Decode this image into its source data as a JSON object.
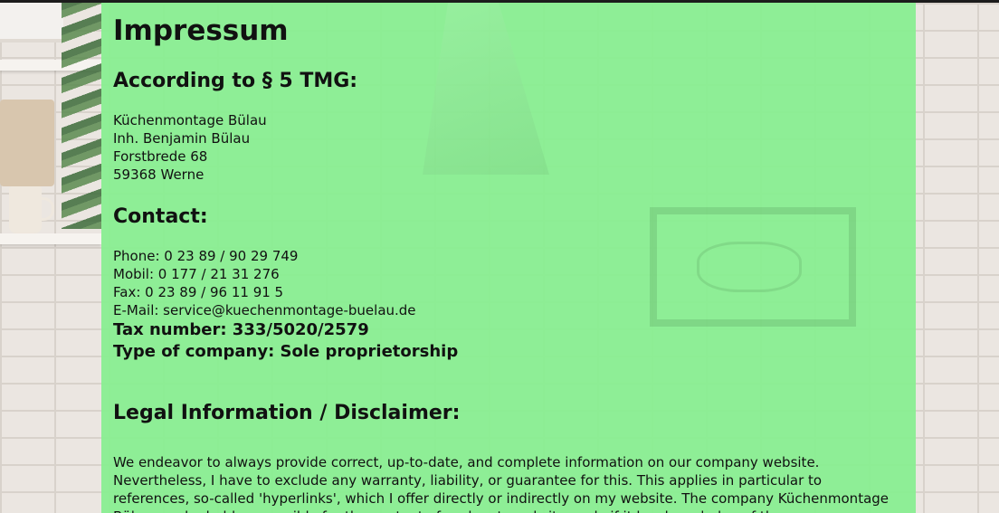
{
  "page": {
    "title": "Impressum"
  },
  "tmg": {
    "heading": "According to § 5 TMG:",
    "lines": [
      "Küchenmontage Bülau",
      "Inh. Benjamin Bülau",
      "Forstbrede 68",
      "59368 Werne"
    ]
  },
  "contact": {
    "heading": "Contact:",
    "lines": [
      "Phone: 0 23 89 / 90 29 749",
      "Mobil: 0 177 / 21 31 276",
      "Fax: 0 23 89 / 96 11 91 5",
      "E-Mail: service@kuechenmontage-buelau.de"
    ],
    "tax_number": "Tax number: 333/5020/2579",
    "company_type": "Type of company: Sole proprietorship"
  },
  "legal": {
    "heading": "Legal Information / Disclaimer:",
    "paragraph": "We endeavor to always provide correct, up-to-date, and complete information on our company website. Nevertheless, I have to exclude any warranty, liability, or guarantee for this. This applies in particular to references, so-called 'hyperlinks', which I offer directly or indirectly on my website. The company Küchenmontage Bülau can be held responsible for the content of such external sites only if it has knowledge of them."
  },
  "colors": {
    "panel": "#88EE90",
    "text": "#111111",
    "topbar": "#1C1C1C"
  }
}
